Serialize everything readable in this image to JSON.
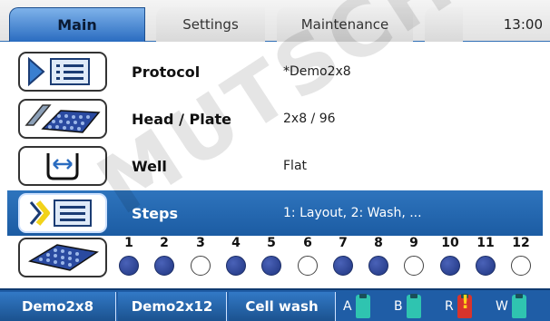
{
  "tabs": [
    {
      "label": "Main",
      "active": true
    },
    {
      "label": "Settings",
      "active": false
    },
    {
      "label": "Maintenance",
      "active": false
    },
    {
      "label": "",
      "active": false
    }
  ],
  "clock": "13:00",
  "rows": [
    {
      "icon": "protocol-list-icon",
      "label": "Protocol",
      "value": "*Demo2x8"
    },
    {
      "icon": "head-plate-icon",
      "label": "Head / Plate",
      "value": "2x8 / 96"
    },
    {
      "icon": "well-flat-icon",
      "label": "Well",
      "value": "Flat"
    },
    {
      "icon": "steps-list-icon",
      "label": "Steps",
      "value": "1: Layout, 2: Wash, ...",
      "selected": true
    }
  ],
  "wells": {
    "icon": "plate-icon",
    "columns": [
      {
        "num": "1",
        "filled": true
      },
      {
        "num": "2",
        "filled": true
      },
      {
        "num": "3",
        "filled": false
      },
      {
        "num": "4",
        "filled": true
      },
      {
        "num": "5",
        "filled": true
      },
      {
        "num": "6",
        "filled": false
      },
      {
        "num": "7",
        "filled": true
      },
      {
        "num": "8",
        "filled": true
      },
      {
        "num": "9",
        "filled": false
      },
      {
        "num": "10",
        "filled": true
      },
      {
        "num": "11",
        "filled": true
      },
      {
        "num": "12",
        "filled": false
      }
    ]
  },
  "bottom": {
    "buttons": [
      "Demo2x8",
      "Demo2x12",
      "Cell wash"
    ],
    "bottles": [
      {
        "letter": "A",
        "color": "#2fc4b0",
        "alert": false
      },
      {
        "letter": "B",
        "color": "#2fc4b0",
        "alert": false
      },
      {
        "letter": "R",
        "color": "#d8342c",
        "alert": true
      },
      {
        "letter": "W",
        "color": "#2fc4b0",
        "alert": false
      }
    ]
  },
  "watermark": "MUTSCHEL",
  "colors": {
    "accent": "#1f5da6",
    "selected_row": "#2e74bd",
    "well_fill": "#2a3f8f"
  }
}
